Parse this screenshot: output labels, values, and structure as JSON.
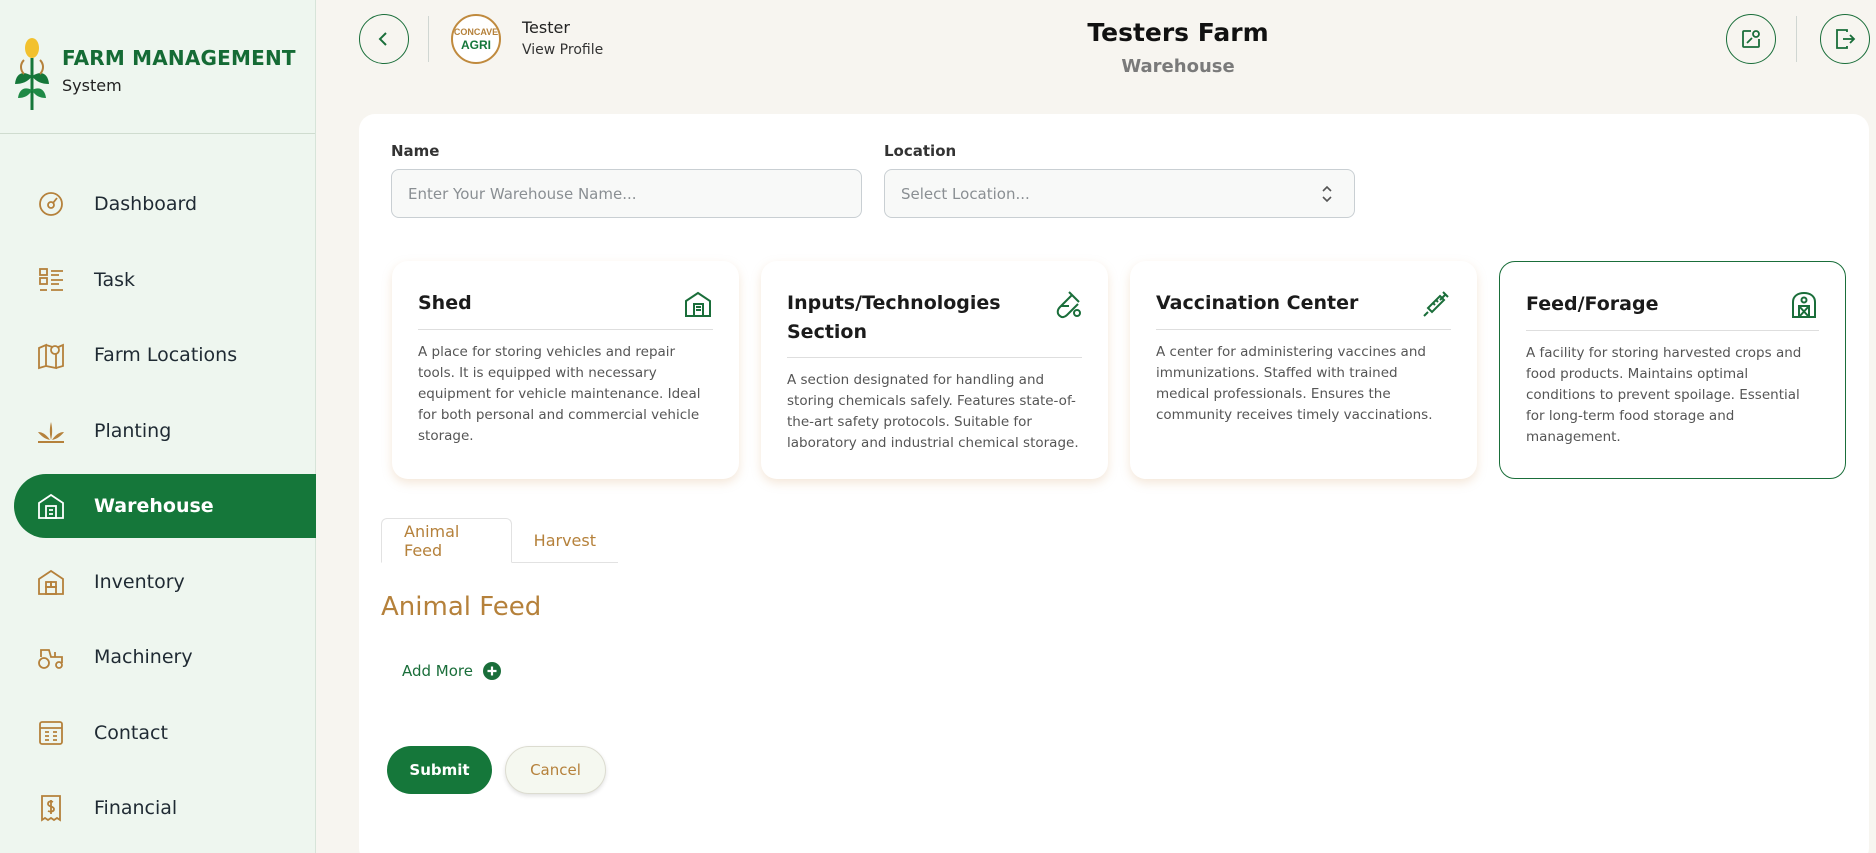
{
  "brand": {
    "title": "FARM MANAGEMENT",
    "subtitle": "System",
    "logo_icon": "wheat-logo-icon",
    "colors": {
      "primary": "#15773a",
      "accent": "#b5813b",
      "logo_yellow": "#f2c12e"
    }
  },
  "sidebar": {
    "items": [
      {
        "label": "Dashboard",
        "icon": "gauge-icon",
        "active": false
      },
      {
        "label": "Task",
        "icon": "task-list-icon",
        "active": false
      },
      {
        "label": "Farm Locations",
        "icon": "map-pin-icon",
        "active": false
      },
      {
        "label": "Planting",
        "icon": "plant-icon",
        "active": false
      },
      {
        "label": "Warehouse",
        "icon": "warehouse-icon",
        "active": true
      },
      {
        "label": "Inventory",
        "icon": "inventory-icon",
        "active": false
      },
      {
        "label": "Machinery",
        "icon": "tractor-icon",
        "active": false
      },
      {
        "label": "Contact",
        "icon": "contact-icon",
        "active": false
      },
      {
        "label": "Financial",
        "icon": "receipt-icon",
        "active": false
      }
    ]
  },
  "header": {
    "user_name": "Tester",
    "view_profile": "View Profile",
    "avatar_text": "CONCAVE AGRI",
    "farm_title": "Testers Farm",
    "page_subtitle": "Warehouse"
  },
  "form": {
    "name_label": "Name",
    "name_placeholder": "Enter Your Warehouse Name...",
    "location_label": "Location",
    "location_placeholder": "Select Location..."
  },
  "warehouse_types": [
    {
      "title": "Shed",
      "icon": "building-icon",
      "selected": false,
      "description": "A place for storing vehicles and repair tools. It is equipped with necessary equipment for vehicle maintenance. Ideal for both personal and commercial vehicle storage."
    },
    {
      "title": "Inputs/Technologies Section",
      "icon": "flask-icon",
      "selected": false,
      "description": "A section designated for handling and storing chemicals safely. Features state-of-the-art safety protocols. Suitable for laboratory and industrial chemical storage."
    },
    {
      "title": "Vaccination Center",
      "icon": "syringe-icon",
      "selected": false,
      "description": "A center for administering vaccines and immunizations. Staffed with trained medical professionals. Ensures the community receives timely vaccinations."
    },
    {
      "title": "Feed/Forage",
      "icon": "barn-icon",
      "selected": true,
      "description": "A facility for storing harvested crops and food products. Maintains optimal conditions to prevent spoilage. Essential for long-term food storage and management."
    }
  ],
  "tabs": [
    {
      "label": "Animal Feed",
      "active": true
    },
    {
      "label": "Harvest",
      "active": false
    }
  ],
  "section": {
    "title": "Animal Feed",
    "add_more": "Add More"
  },
  "actions": {
    "submit": "Submit",
    "cancel": "Cancel"
  }
}
